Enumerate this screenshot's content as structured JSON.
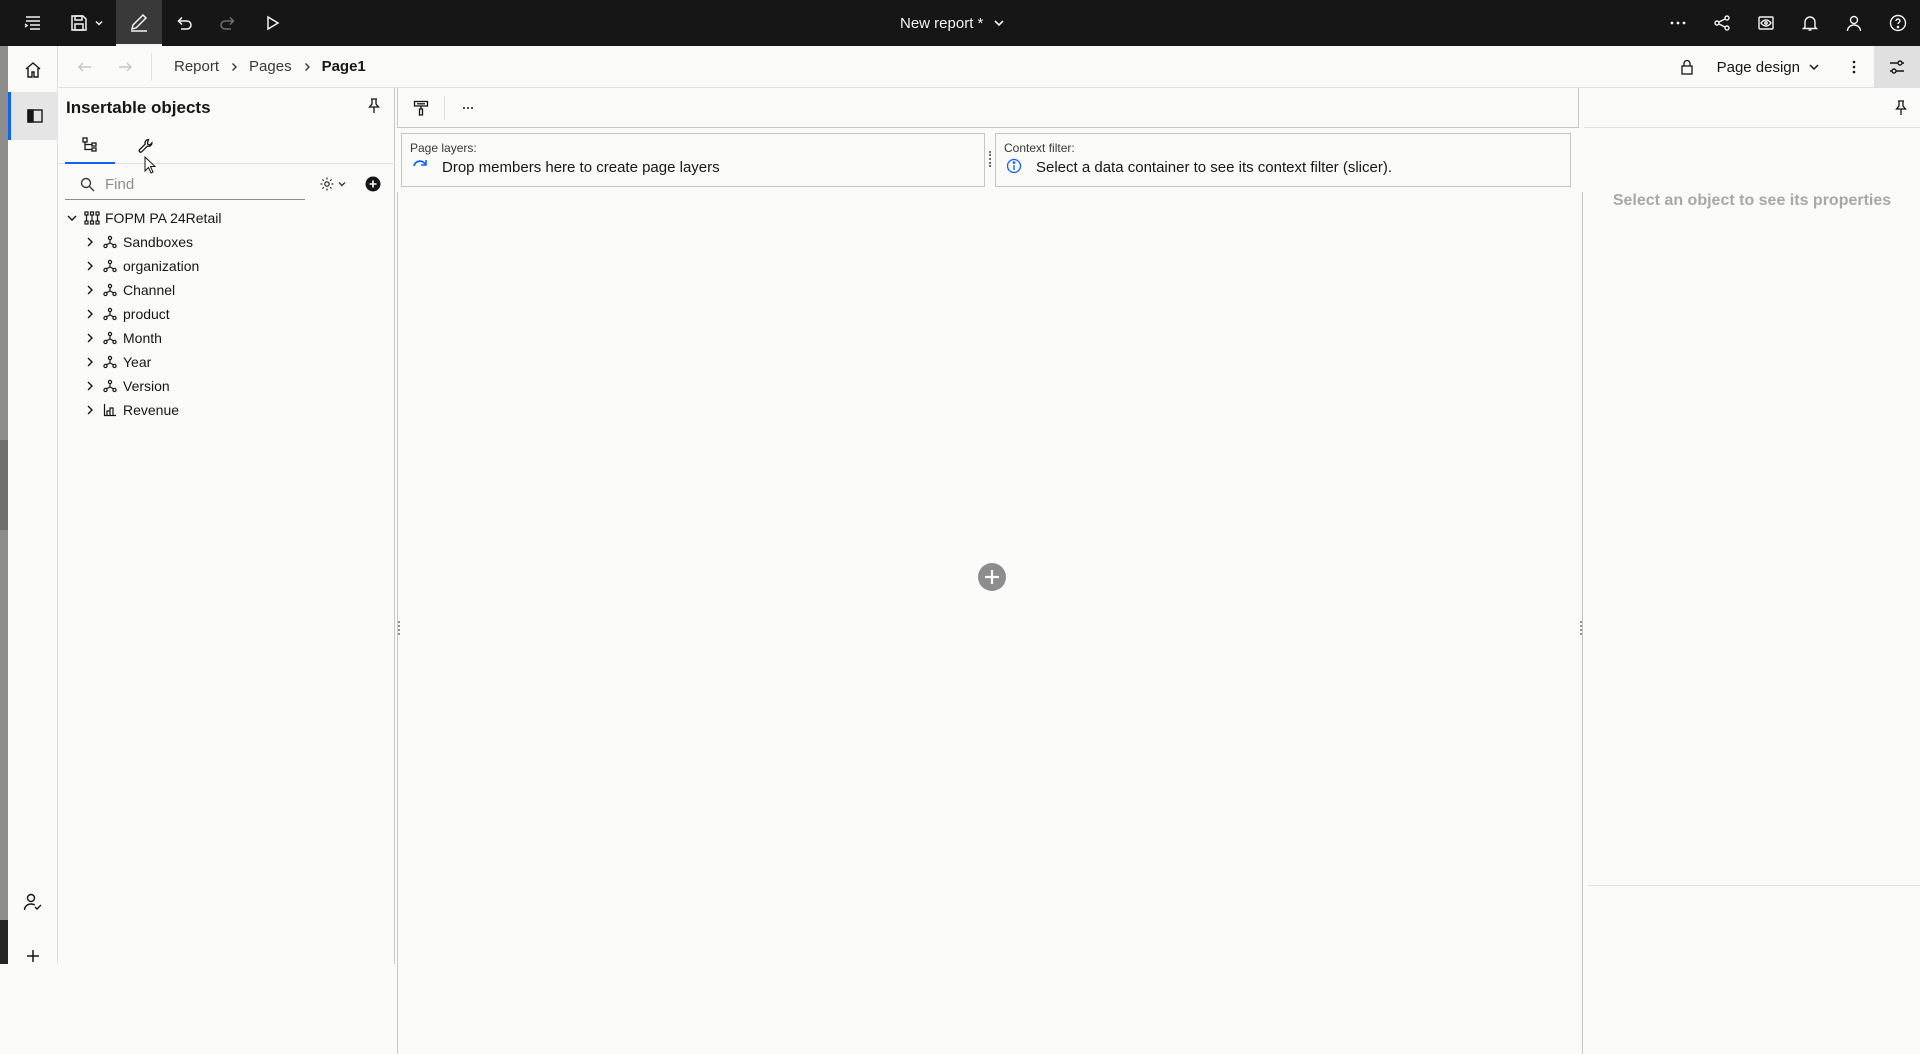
{
  "app": {
    "title": "New report *"
  },
  "breadcrumb": {
    "items": [
      "Report",
      "Pages",
      "Page1"
    ]
  },
  "mode": {
    "label": "Page design"
  },
  "insertable_panel": {
    "title": "Insertable objects",
    "find_placeholder": "Find",
    "tree": {
      "root": "FOPM PA 24Retail",
      "children": [
        "Sandboxes",
        "organization",
        "Channel",
        "product",
        "Month",
        "Year",
        "Version",
        "Revenue"
      ]
    }
  },
  "canvas": {
    "page_layers_label": "Page layers:",
    "page_layers_text": "Drop members here to create page layers",
    "context_filter_label": "Context filter:",
    "context_filter_text": "Select a data container to see its context filter (slicer)."
  },
  "properties": {
    "empty_text": "Select an object to see its properties"
  },
  "colors": {
    "topbar_bg": "#161616",
    "accent": "#0f62fe",
    "canvas_bg": "#fafaf8"
  }
}
